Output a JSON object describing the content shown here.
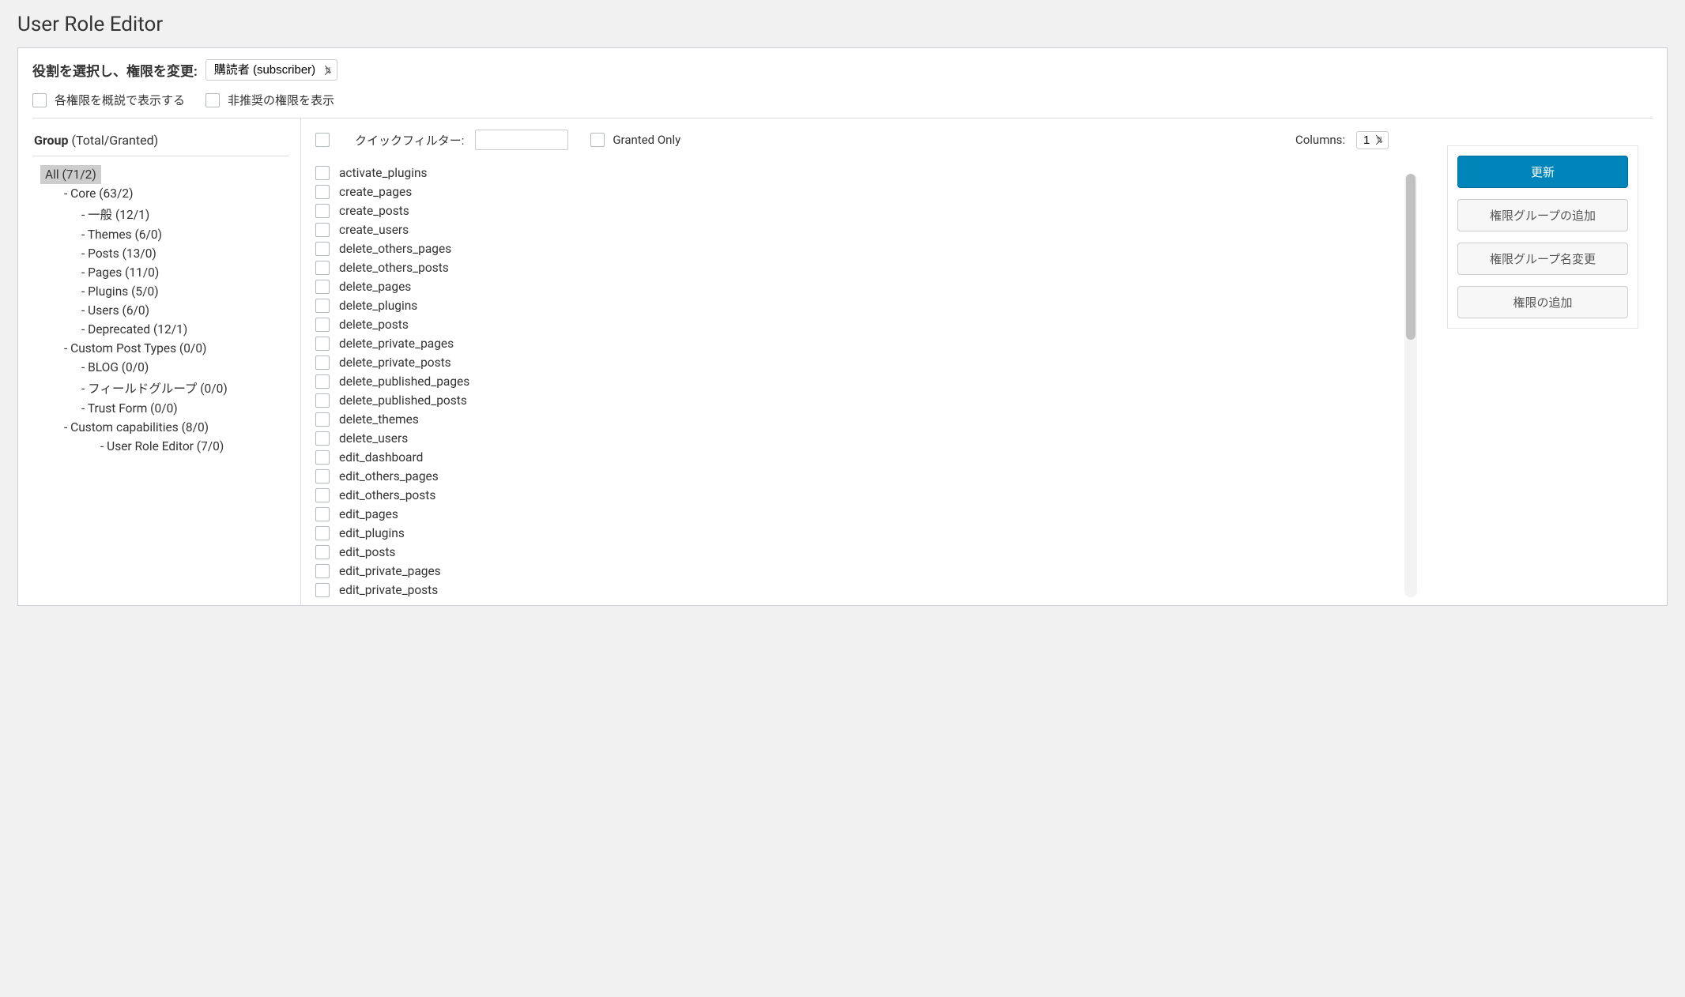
{
  "page_title": "User Role Editor",
  "role_select": {
    "label": "役割を選択し、権限を変更:",
    "selected": "購読者 (subscriber)"
  },
  "options": {
    "show_desc": "各権限を概説で表示する",
    "show_deprecated": "非推奨の権限を表示"
  },
  "sidebar": {
    "header_strong": "Group",
    "header_rest": " (Total/Granted)",
    "tree": [
      {
        "label": "All (71/2)",
        "level": 0,
        "dash": false,
        "selected": true
      },
      {
        "label": "Core (63/2)",
        "level": 1,
        "dash": true
      },
      {
        "label": "一般 (12/1)",
        "level": 2,
        "dash": true
      },
      {
        "label": "Themes (6/0)",
        "level": 2,
        "dash": true
      },
      {
        "label": "Posts (13/0)",
        "level": 2,
        "dash": true
      },
      {
        "label": "Pages (11/0)",
        "level": 2,
        "dash": true
      },
      {
        "label": "Plugins (5/0)",
        "level": 2,
        "dash": true
      },
      {
        "label": "Users (6/0)",
        "level": 2,
        "dash": true
      },
      {
        "label": "Deprecated (12/1)",
        "level": 2,
        "dash": true
      },
      {
        "label": "Custom Post Types (0/0)",
        "level": 1,
        "dash": true
      },
      {
        "label": "BLOG (0/0)",
        "level": 2,
        "dash": true
      },
      {
        "label": "フィールドグループ (0/0)",
        "level": 2,
        "dash": true
      },
      {
        "label": "Trust Form (0/0)",
        "level": 2,
        "dash": true
      },
      {
        "label": "Custom capabilities (8/0)",
        "level": 1,
        "dash": true
      },
      {
        "label": "User Role Editor (7/0)",
        "level": 3,
        "dash": true
      }
    ]
  },
  "filter": {
    "quick_label": "クイックフィルター:",
    "granted_only": "Granted Only",
    "columns_label": "Columns:",
    "columns_value": "1"
  },
  "capabilities": [
    "activate_plugins",
    "create_pages",
    "create_posts",
    "create_users",
    "delete_others_pages",
    "delete_others_posts",
    "delete_pages",
    "delete_plugins",
    "delete_posts",
    "delete_private_pages",
    "delete_private_posts",
    "delete_published_pages",
    "delete_published_posts",
    "delete_themes",
    "delete_users",
    "edit_dashboard",
    "edit_others_pages",
    "edit_others_posts",
    "edit_pages",
    "edit_plugins",
    "edit_posts",
    "edit_private_pages",
    "edit_private_posts"
  ],
  "actions": {
    "update": "更新",
    "add_group": "権限グループの追加",
    "rename_group": "権限グループ名変更",
    "add_cap": "権限の追加"
  }
}
